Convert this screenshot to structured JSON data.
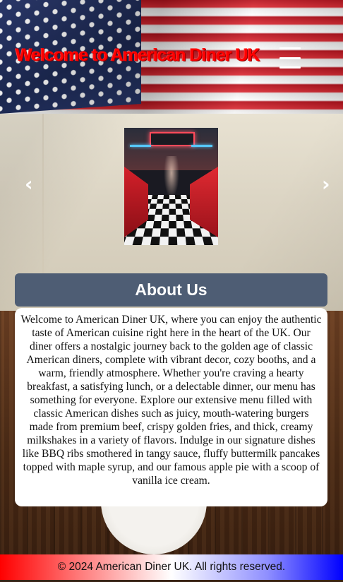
{
  "header": {
    "title": "Welcome to American Diner UK",
    "menu_icon": "hamburger-menu-icon"
  },
  "carousel": {
    "prev_label": "‹",
    "next_label": "›",
    "image_alt": "American diner interior"
  },
  "about": {
    "heading": "About Us",
    "body": "Welcome to American Diner UK, where you can enjoy the authentic taste of American cuisine right here in the heart of the UK. Our diner offers a nostalgic journey back to the golden age of classic American diners, complete with vibrant decor, cozy booths, and a warm, friendly atmosphere. Whether you're craving a hearty breakfast, a satisfying lunch, or a delectable dinner, our menu has something for everyone. Explore our extensive menu filled with classic American dishes such as juicy, mouth-watering burgers made from premium beef, crispy golden fries, and thick, creamy milkshakes in a variety of flavors. Indulge in our signature dishes like BBQ ribs smothered in tangy sauce, fluffy buttermilk pancakes topped with maple syrup, and our famous apple pie with a scoop of vanilla ice cream."
  },
  "footer": {
    "copyright": "© 2024 American Diner UK. All rights reserved."
  },
  "colors": {
    "title_red": "#ff0000",
    "about_heading_bg": "#4e5d74",
    "footer_gradient": [
      "#ff0000",
      "#ffffff",
      "#0000ff"
    ]
  }
}
